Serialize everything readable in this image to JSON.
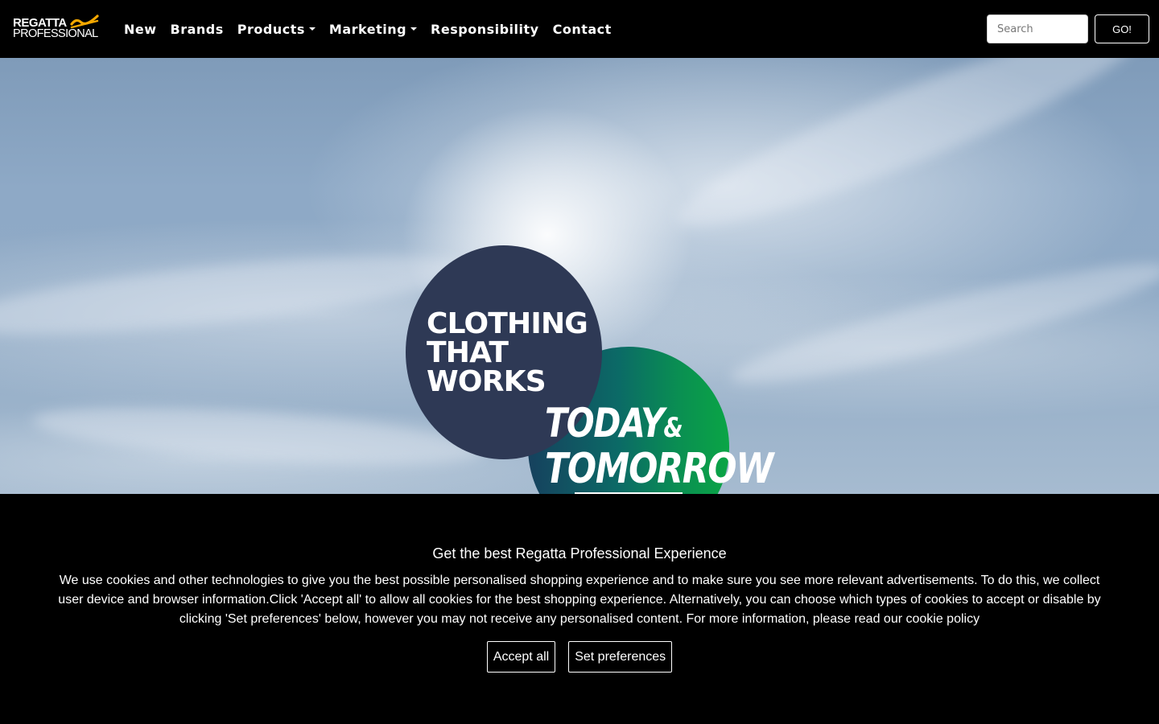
{
  "brand": {
    "line1": "REGATTA",
    "line2": "PROFESSIONAL",
    "accent_color": "#f5a800"
  },
  "nav": {
    "items": [
      {
        "label": "New",
        "dropdown": false
      },
      {
        "label": "Brands",
        "dropdown": false
      },
      {
        "label": "Products",
        "dropdown": true
      },
      {
        "label": "Marketing",
        "dropdown": true
      },
      {
        "label": "Responsibility",
        "dropdown": false
      },
      {
        "label": "Contact",
        "dropdown": false
      }
    ]
  },
  "search": {
    "placeholder": "Search",
    "value": "",
    "button_label": "GO!"
  },
  "hero": {
    "badge_left": [
      "CLOTHING",
      "THAT",
      "WORKS"
    ],
    "badge_right_line1": "TODAY",
    "badge_right_amp": "&",
    "badge_right_line2": "TOMORROW",
    "colors": {
      "navy": "#2e3955",
      "green": "#0aa545",
      "teal": "#16415e"
    }
  },
  "cookie": {
    "title": "Get the best Regatta Professional Experience",
    "text": "We use cookies and other technologies to give you the best possible personalised shopping experience and to make sure you see more relevant advertisements. To do this, we collect user device and browser information.Click 'Accept all' to allow all cookies for the best shopping experience. Alternatively, you can choose which types of cookies to accept or disable by clicking 'Set preferences' below, however you may not receive any personalised content. For more information, please read our cookie policy",
    "accept_label": "Accept all",
    "preferences_label": "Set preferences"
  }
}
